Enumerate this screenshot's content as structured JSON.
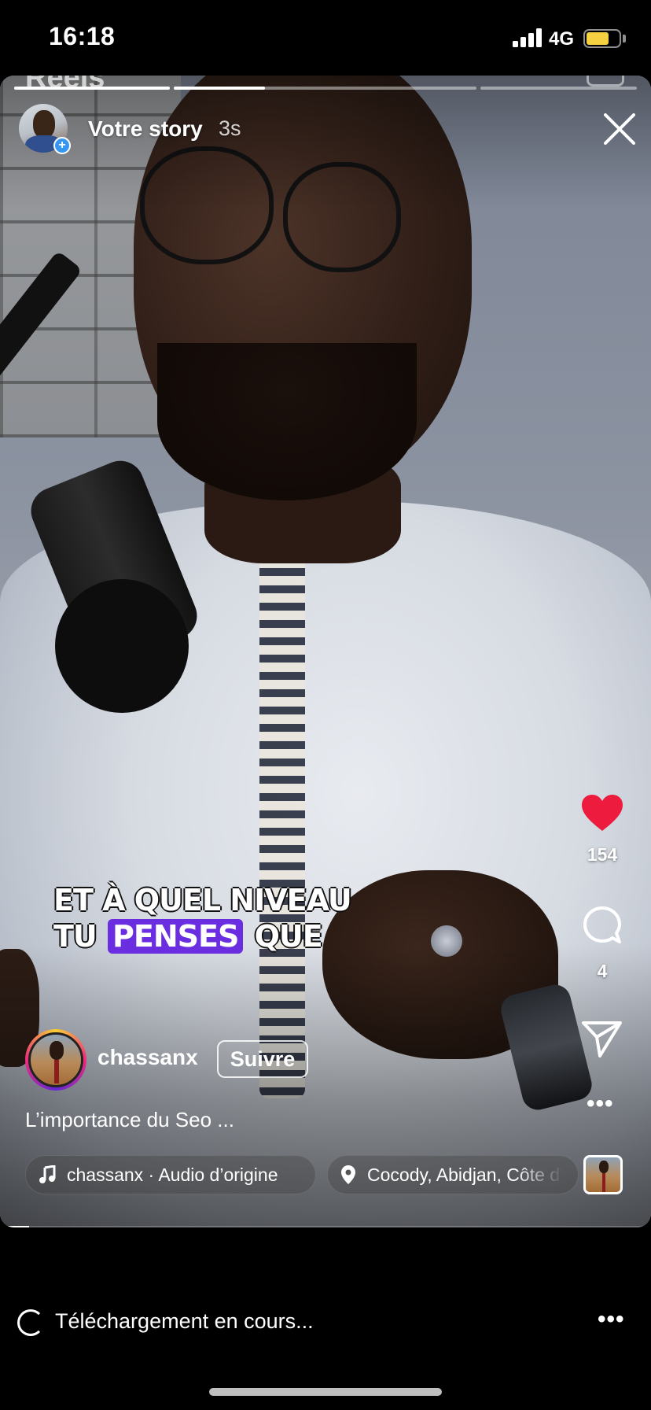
{
  "status_bar": {
    "time": "16:18",
    "network": "4G",
    "battery_level": 0.7,
    "battery_color": "#f5d142"
  },
  "story": {
    "header_peek": "Reels",
    "progress_segments": [
      {
        "state": "viewed"
      },
      {
        "state": "current",
        "progress": 0.3
      },
      {
        "state": "upcoming"
      }
    ],
    "owner_label": "Votre story",
    "elapsed": "3s",
    "close_icon": "close-icon"
  },
  "captions": {
    "line1": "ET À QUEL NIVEAU",
    "line2_before": "TU",
    "line2_highlight": "PENSES",
    "line2_after": "QUE",
    "highlight_color": "#6a2ee0"
  },
  "actions": {
    "likes": "154",
    "comments": "4",
    "like_color": "#ed1b3e"
  },
  "reel": {
    "author": "chassanx",
    "follow_label": "Suivre",
    "description": "L’importance du Seo ...",
    "audio": "chassanx · Audio d’origine",
    "location": "Cocody, Abidjan, Côte d’Ivoire",
    "video_progress": 0.045
  },
  "bottom": {
    "upload_status": "Téléchargement en cours..."
  }
}
